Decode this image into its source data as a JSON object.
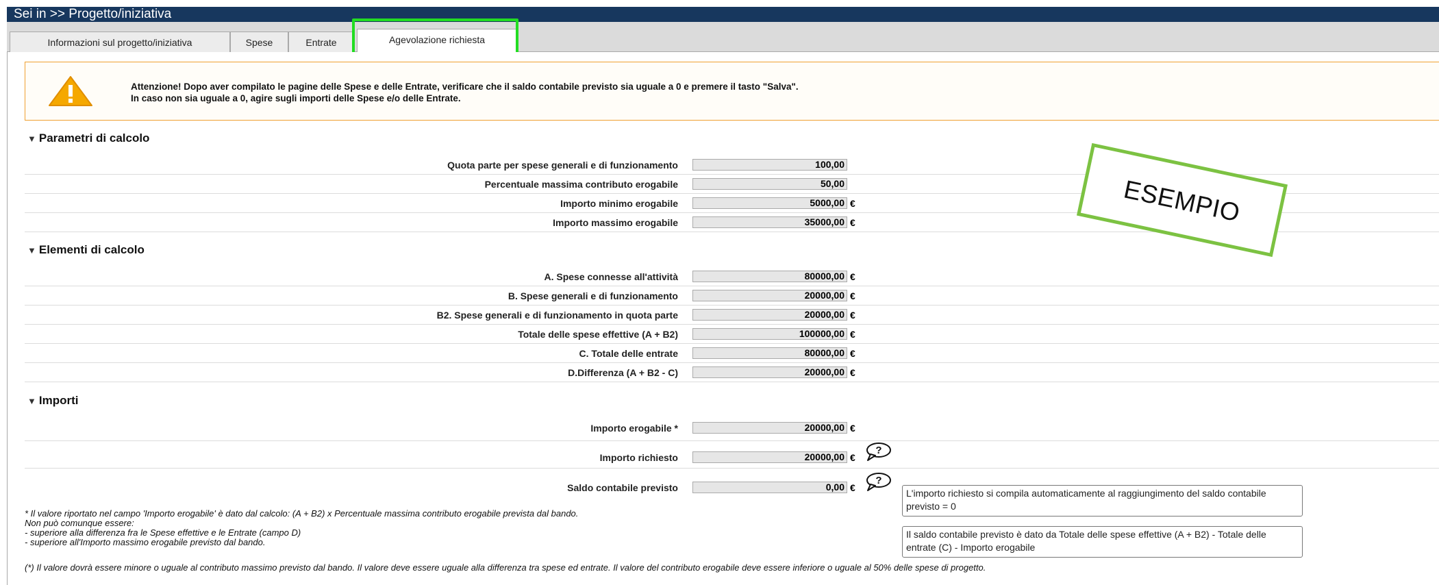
{
  "titlebar": {
    "text": "Sei in >> Progetto/iniziativa"
  },
  "tabs": [
    {
      "label": "Informazioni sul progetto/iniziativa"
    },
    {
      "label": "Spese"
    },
    {
      "label": "Entrate"
    },
    {
      "label": "Agevolazione richiesta"
    }
  ],
  "warning": {
    "line1": "Attenzione! Dopo aver compilato le pagine delle Spese e delle Entrate, verificare che il saldo contabile previsto sia uguale a 0 e premere il tasto \"Salva\".",
    "line2": "In caso non sia uguale a 0, agire sugli importi delle Spese e/o delle Entrate."
  },
  "sections": {
    "parametri": {
      "title": "Parametri di calcolo",
      "rows": [
        {
          "label": "Quota parte per spese generali e di funzionamento",
          "value": "100,00",
          "unit": ""
        },
        {
          "label": "Percentuale massima contributo erogabile",
          "value": "50,00",
          "unit": ""
        },
        {
          "label": "Importo minimo erogabile",
          "value": "5000,00",
          "unit": "€"
        },
        {
          "label": "Importo massimo erogabile",
          "value": "35000,00",
          "unit": "€"
        }
      ]
    },
    "elementi": {
      "title": "Elementi di calcolo",
      "rows": [
        {
          "label": "A. Spese connesse all'attività",
          "value": "80000,00",
          "unit": "€"
        },
        {
          "label": "B. Spese generali e di funzionamento",
          "value": "20000,00",
          "unit": "€"
        },
        {
          "label": "B2. Spese generali e di funzionamento in quota parte",
          "value": "20000,00",
          "unit": "€"
        },
        {
          "label": "Totale delle spese effettive (A + B2)",
          "value": "100000,00",
          "unit": "€"
        },
        {
          "label": "C. Totale delle entrate",
          "value": "80000,00",
          "unit": "€"
        },
        {
          "label": "D.Differenza (A + B2 - C)",
          "value": "20000,00",
          "unit": "€"
        }
      ]
    },
    "importi": {
      "title": "Importi",
      "rows": [
        {
          "label": "Importo erogabile *",
          "value": "20000,00",
          "unit": "€"
        },
        {
          "label": "Importo richiesto",
          "value": "20000,00",
          "unit": "€"
        },
        {
          "label": "Saldo contabile previsto",
          "value": "0,00",
          "unit": "€"
        }
      ]
    }
  },
  "tooltips": {
    "richiesto": "L'importo richiesto si compila automaticamente al raggiungimento del saldo contabile previsto = 0",
    "saldo": "Il saldo contabile previsto è dato da Totale delle spese effettive (A + B2) - Totale delle entrate (C) - Importo erogabile"
  },
  "stamp": {
    "text": "ESEMPIO"
  },
  "notes": {
    "n1": "* Il valore riportato nel campo 'Importo erogabile' è dato dal calcolo: (A + B2) x Percentuale massima contributo erogabile prevista dal bando.",
    "n2": "Non può comunque essere:",
    "n3": "- superiore alla differenza fra le Spese effettive e le Entrate (campo D)",
    "n4": "- superiore all'Importo massimo erogabile previsto dal bando.",
    "n5": "(*) Il valore dovrà essere minore o uguale al contributo massimo previsto dal bando. Il valore deve essere uguale alla differenza tra spese ed entrate. Il valore del contributo erogabile deve essere inferiore o uguale al 50% delle spese di progetto."
  },
  "colors": {
    "titlebar": "#17375e",
    "highlight": "#22dd22",
    "stamp_border": "#7cc242",
    "warning_border": "#f0a030",
    "warning_icon": "#f5a800"
  },
  "icons": [
    "warning-icon",
    "help-bubble-icon",
    "collapse-triangle-icon"
  ]
}
